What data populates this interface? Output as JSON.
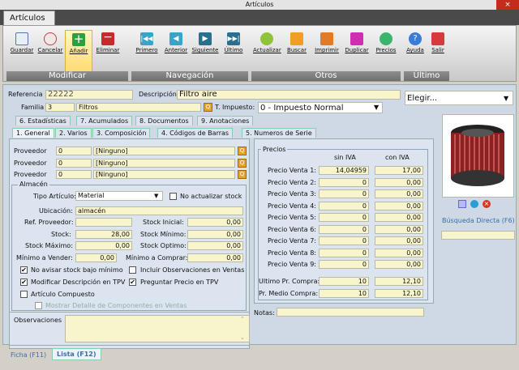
{
  "window": {
    "title": "Artículos",
    "close": "×"
  },
  "app_tab": "Artículos",
  "ribbon": {
    "groups": [
      "Modificar",
      "Navegación",
      "Otros",
      "Último"
    ],
    "buttons": {
      "guardar": "Guardar",
      "cancelar": "Cancelar",
      "anadir": "Añadir",
      "eliminar": "Eliminar",
      "primero": "Primero",
      "anterior": "Anterior",
      "siguiente": "Siguiente",
      "ultimo": "Último",
      "actualizar": "Actualizar",
      "buscar": "Buscar",
      "imprimir": "Imprimir",
      "duplicar": "Duplicar",
      "precios": "Precios",
      "ayuda": "Ayuda",
      "salir": "Salir"
    }
  },
  "header": {
    "referencia_label": "Referencia",
    "referencia_value": "22222",
    "descripcion_label": "Descripción",
    "descripcion_value": "Filtro aire",
    "familia_label": "Familia",
    "familia_code": "3",
    "familia_name": "Filtros",
    "impuesto_label": "T. Impuesto:",
    "impuesto_value": "0 - Impuesto Normal",
    "elegir_value": "Elegir..."
  },
  "tabs_row1": [
    "6. Estadísticas",
    "7. Acumulados",
    "8. Documentos",
    "9. Anotaciones"
  ],
  "tabs_row2": [
    "1. General",
    "2. Varios",
    "3. Composición",
    "4. Códigos de Barras",
    "5. Numeros de Serie"
  ],
  "general": {
    "proveedor_label": "Proveedor",
    "proveedores": [
      {
        "code": "0",
        "name": "[Ninguno]"
      },
      {
        "code": "0",
        "name": "[Ninguno]"
      },
      {
        "code": "0",
        "name": "[Ninguno]"
      }
    ],
    "almacen": {
      "title": "Almacén",
      "tipo_label": "Tipo Artículo:",
      "tipo_value": "Material",
      "no_actualizar": "No actualizar stock",
      "ubicacion_label": "Ubicación:",
      "ubicacion_value": "almacén",
      "ref_prov_label": "Ref. Proveedor:",
      "stock_inicial_label": "Stock Inicial:",
      "stock_inicial": "0,00",
      "stock_label": "Stock:",
      "stock": "28,00",
      "stock_minimo_label": "Stock Mínimo:",
      "stock_minimo": "0,00",
      "stock_maximo_label": "Stock Máximo:",
      "stock_maximo": "0,00",
      "stock_optimo_label": "Stock Optimo:",
      "stock_optimo": "0,00",
      "min_vender_label": "Mínimo a Vender:",
      "min_vender": "0,00",
      "min_comprar_label": "Mínimo a Comprar:",
      "min_comprar": "0,00",
      "chk_no_avisar": "No avisar stock bajo mínimo",
      "chk_incluir": "Incluir Observaciones en Ventas",
      "chk_modificar": "Modificar Descripción en TPV",
      "chk_preguntar": "Preguntar Precio en TPV",
      "chk_compuesto": "Artículo Compuesto",
      "chk_mostrar": "Mostrar Detalle de Componentes en Ventas"
    },
    "observaciones_label": "Observaciones"
  },
  "precios": {
    "title": "Precios",
    "col_sin": "sin IVA",
    "col_con": "con IVA",
    "rows": [
      {
        "label": "Precio Venta 1:",
        "sin": "14,04959",
        "con": "17,00"
      },
      {
        "label": "Precio Venta 2:",
        "sin": "0",
        "con": "0,00"
      },
      {
        "label": "Precio Venta 3:",
        "sin": "0",
        "con": "0,00"
      },
      {
        "label": "Precio Venta 4:",
        "sin": "0",
        "con": "0,00"
      },
      {
        "label": "Precio Venta 5:",
        "sin": "0",
        "con": "0,00"
      },
      {
        "label": "Precio Venta 6:",
        "sin": "0",
        "con": "0,00"
      },
      {
        "label": "Precio Venta 7:",
        "sin": "0",
        "con": "0,00"
      },
      {
        "label": "Precio Venta 8:",
        "sin": "0",
        "con": "0,00"
      },
      {
        "label": "Precio Venta 9:",
        "sin": "0",
        "con": "0,00"
      }
    ],
    "ultimo_label": "Ultimo Pr. Compra:",
    "ultimo_sin": "10",
    "ultimo_con": "12,10",
    "medio_label": "Pr. Medio Compra:",
    "medio_sin": "10",
    "medio_con": "12,10",
    "notas_label": "Notas:"
  },
  "side": {
    "busqueda": "Búsqueda Directa (F6)"
  },
  "bottom_tabs": [
    "Ficha (F11)",
    "Lista (F12)"
  ]
}
